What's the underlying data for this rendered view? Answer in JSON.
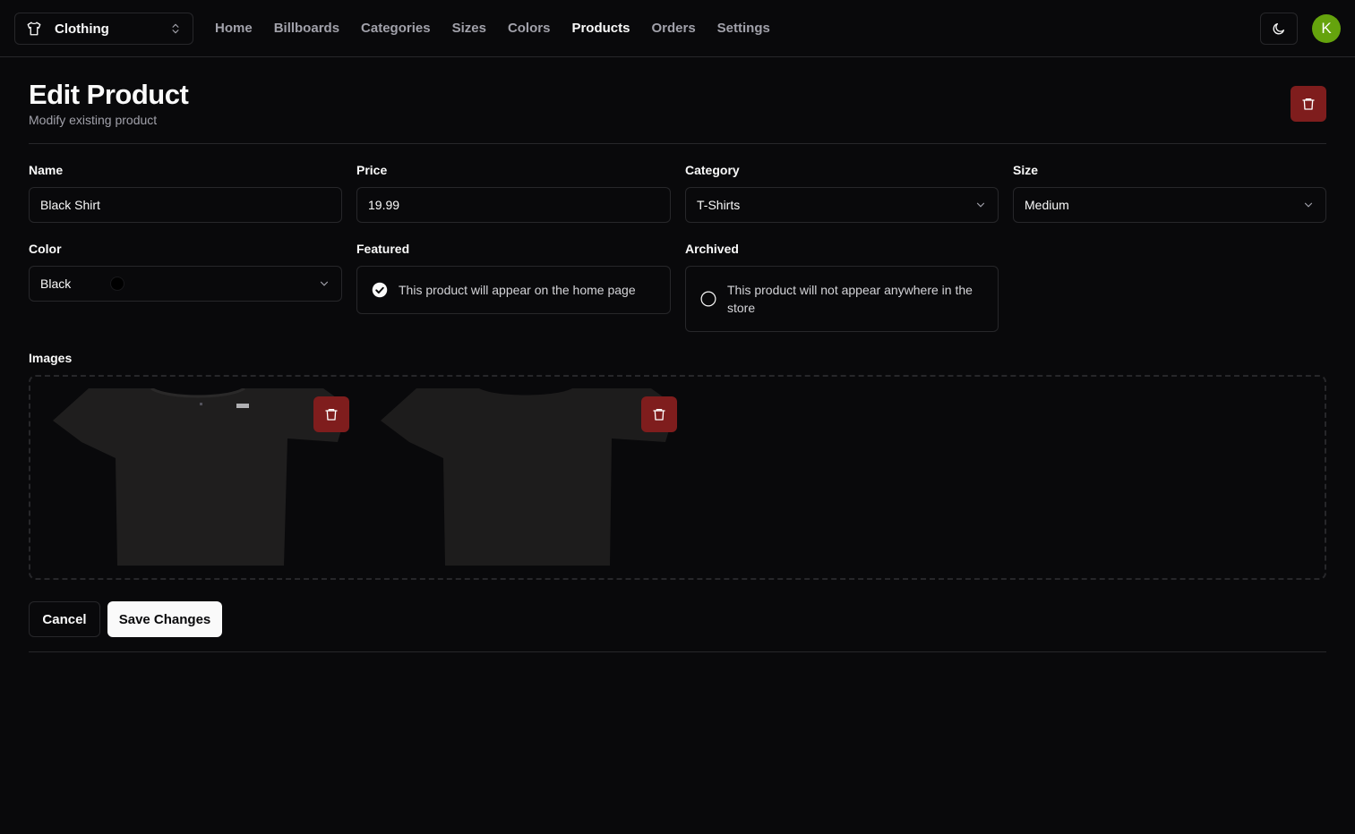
{
  "store": {
    "name": "Clothing"
  },
  "nav": [
    {
      "label": "Home"
    },
    {
      "label": "Billboards"
    },
    {
      "label": "Categories"
    },
    {
      "label": "Sizes"
    },
    {
      "label": "Colors"
    },
    {
      "label": "Products",
      "active": true
    },
    {
      "label": "Orders"
    },
    {
      "label": "Settings"
    }
  ],
  "user": {
    "initial": "K"
  },
  "header": {
    "title": "Edit Product",
    "subtitle": "Modify existing product"
  },
  "form": {
    "name_label": "Name",
    "name_value": "Black Shirt",
    "price_label": "Price",
    "price_value": "19.99",
    "category_label": "Category",
    "category_value": "T-Shirts",
    "size_label": "Size",
    "size_value": "Medium",
    "color_label": "Color",
    "color_value": "Black",
    "color_hex": "#000000",
    "featured_label": "Featured",
    "featured_text": "This product will appear on the home page",
    "featured_checked": true,
    "archived_label": "Archived",
    "archived_text": "This product will not appear anywhere in the store",
    "archived_checked": false,
    "images_label": "Images"
  },
  "actions": {
    "cancel": "Cancel",
    "save": "Save Changes"
  },
  "colors": {
    "background": "#09090b",
    "border": "#27272a",
    "danger": "#7f1d1d",
    "muted": "#a1a1aa",
    "avatar": "#65a30d"
  }
}
